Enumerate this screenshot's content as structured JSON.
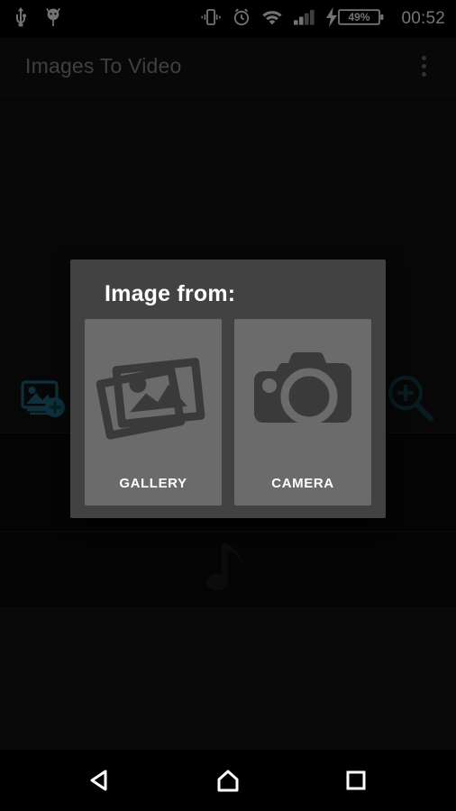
{
  "status_bar": {
    "icons_left": [
      "usb-icon",
      "android-debug-icon"
    ],
    "icons_right": [
      "vibrate-icon",
      "alarm-icon",
      "wifi-icon",
      "cellular-signal-icon",
      "charging-battery-icon"
    ],
    "battery_percent": "49%",
    "clock": "00:52"
  },
  "action_bar": {
    "title": "Images To Video",
    "overflow_menu": "overflow-menu-icon"
  },
  "background": {
    "add_image_icon": "add-photo-icon",
    "zoom_in_icon": "zoom-in-icon",
    "images_placeholder_icon": "images-placeholder-icon",
    "audio_placeholder_icon": "music-note-icon",
    "accent_color": "#1d6b80"
  },
  "dialog": {
    "title": "Image from:",
    "options": [
      {
        "label": "GALLERY",
        "icon": "gallery-photos-icon"
      },
      {
        "label": "CAMERA",
        "icon": "camera-icon"
      }
    ],
    "surface_color": "#424242",
    "card_color": "#6b6b6b"
  },
  "nav_bar": {
    "buttons": [
      {
        "name": "back",
        "icon": "back-triangle-icon"
      },
      {
        "name": "home",
        "icon": "home-icon"
      },
      {
        "name": "recents",
        "icon": "recents-square-icon"
      }
    ]
  }
}
